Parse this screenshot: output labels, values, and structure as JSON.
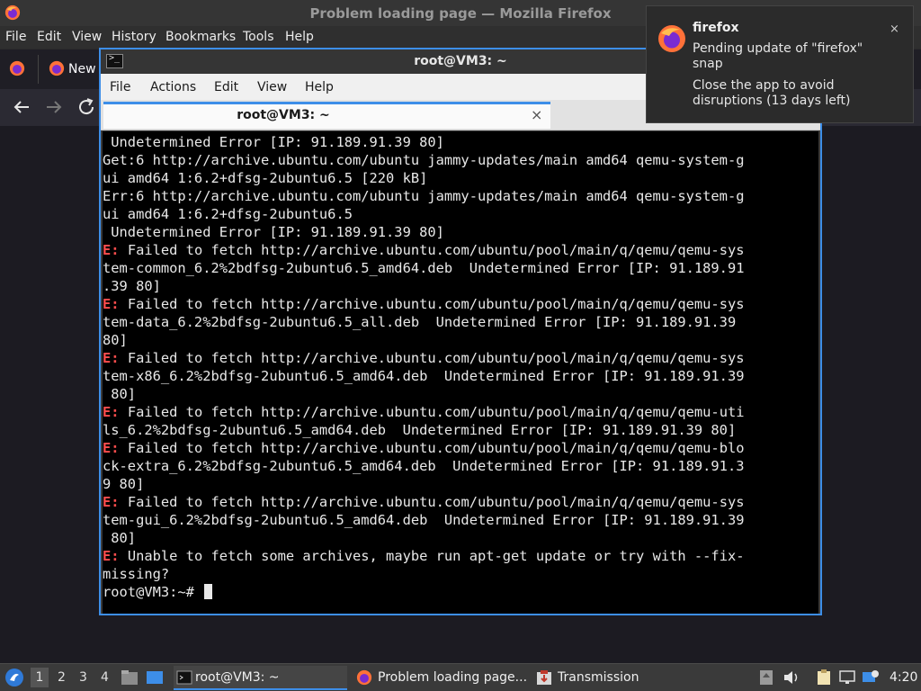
{
  "firefox": {
    "window_title": "Problem loading page — Mozilla Firefox",
    "menu": [
      "File",
      "Edit",
      "View",
      "History",
      "Bookmarks",
      "Tools",
      "Help"
    ],
    "tab_new_label": "New"
  },
  "terminal": {
    "window_title": "root@VM3: ~",
    "menu": [
      "File",
      "Actions",
      "Edit",
      "View",
      "Help"
    ],
    "tab_label": "root@VM3: ~",
    "tab_close": "×",
    "lines": [
      {
        "text": " Undetermined Error [IP: 91.189.91.39 80]"
      },
      {
        "text": "Get:6 http://archive.ubuntu.com/ubuntu jammy-updates/main amd64 qemu-system-g"
      },
      {
        "text": "ui amd64 1:6.2+dfsg-2ubuntu6.5 [220 kB]"
      },
      {
        "text": "Err:6 http://archive.ubuntu.com/ubuntu jammy-updates/main amd64 qemu-system-g"
      },
      {
        "text": "ui amd64 1:6.2+dfsg-2ubuntu6.5"
      },
      {
        "text": " Undetermined Error [IP: 91.189.91.39 80]"
      },
      {
        "prefix": "E:",
        "text": " Failed to fetch http://archive.ubuntu.com/ubuntu/pool/main/q/qemu/qemu-sys"
      },
      {
        "text": "tem-common_6.2%2bdfsg-2ubuntu6.5_amd64.deb  Undetermined Error [IP: 91.189.91"
      },
      {
        "text": ".39 80]"
      },
      {
        "prefix": "E:",
        "text": " Failed to fetch http://archive.ubuntu.com/ubuntu/pool/main/q/qemu/qemu-sys"
      },
      {
        "text": "tem-data_6.2%2bdfsg-2ubuntu6.5_all.deb  Undetermined Error [IP: 91.189.91.39"
      },
      {
        "text": "80]"
      },
      {
        "prefix": "E:",
        "text": " Failed to fetch http://archive.ubuntu.com/ubuntu/pool/main/q/qemu/qemu-sys"
      },
      {
        "text": "tem-x86_6.2%2bdfsg-2ubuntu6.5_amd64.deb  Undetermined Error [IP: 91.189.91.39"
      },
      {
        "text": " 80]"
      },
      {
        "prefix": "E:",
        "text": " Failed to fetch http://archive.ubuntu.com/ubuntu/pool/main/q/qemu/qemu-uti"
      },
      {
        "text": "ls_6.2%2bdfsg-2ubuntu6.5_amd64.deb  Undetermined Error [IP: 91.189.91.39 80]"
      },
      {
        "prefix": "E:",
        "text": " Failed to fetch http://archive.ubuntu.com/ubuntu/pool/main/q/qemu/qemu-blo"
      },
      {
        "text": "ck-extra_6.2%2bdfsg-2ubuntu6.5_amd64.deb  Undetermined Error [IP: 91.189.91.3"
      },
      {
        "text": "9 80]"
      },
      {
        "prefix": "E:",
        "text": " Failed to fetch http://archive.ubuntu.com/ubuntu/pool/main/q/qemu/qemu-sys"
      },
      {
        "text": "tem-gui_6.2%2bdfsg-2ubuntu6.5_amd64.deb  Undetermined Error [IP: 91.189.91.39"
      },
      {
        "text": " 80]"
      },
      {
        "prefix": "E:",
        "text": " Unable to fetch some archives, maybe run apt-get update or try with --fix-"
      },
      {
        "text": "missing?"
      }
    ],
    "prompt": "root@VM3:~# "
  },
  "notification": {
    "app": "firefox",
    "body1": "Pending update of \"firefox\" snap",
    "body2": "Close the app to avoid disruptions (13 days left)",
    "close": "×"
  },
  "taskbar": {
    "workspaces": [
      "1",
      "2",
      "3",
      "4"
    ],
    "tasks": [
      {
        "label": "root@VM3: ~"
      },
      {
        "label": "Problem loading page..."
      },
      {
        "label": "Transmission"
      }
    ],
    "clock": "4:20"
  },
  "colors": {
    "accent": "#3d8ee8",
    "terminal_bg": "#000000",
    "error_red": "#ff4d4d"
  }
}
